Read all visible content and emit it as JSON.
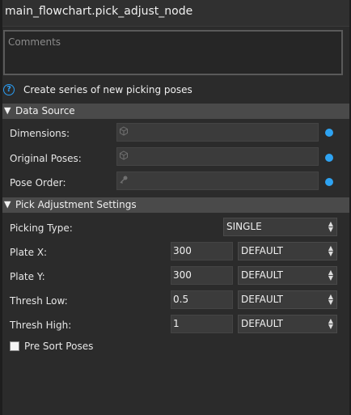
{
  "node": {
    "title": "main_flowchart.pick_adjust_node"
  },
  "comments": {
    "placeholder": "Comments"
  },
  "info": {
    "text": "Create series of new picking poses",
    "icon": "help-circle-icon"
  },
  "sections": {
    "data_source": {
      "title": "Data Source"
    },
    "pick_adjust": {
      "title": "Pick Adjustment Settings"
    }
  },
  "data_source": {
    "dimensions": {
      "label": "Dimensions:"
    },
    "original_poses": {
      "label": "Original Poses:"
    },
    "pose_order": {
      "label": "Pose Order:"
    }
  },
  "pick_adjust": {
    "picking_type": {
      "label": "Picking Type:",
      "value": "SINGLE"
    },
    "plate_x": {
      "label": "Plate X:",
      "value": "300",
      "mode": "DEFAULT"
    },
    "plate_y": {
      "label": "Plate Y:",
      "value": "300",
      "mode": "DEFAULT"
    },
    "thresh_low": {
      "label": "Thresh Low:",
      "value": "0.5",
      "mode": "DEFAULT"
    },
    "thresh_high": {
      "label": "Thresh High:",
      "value": "1",
      "mode": "DEFAULT"
    },
    "pre_sort": {
      "label": "Pre Sort Poses",
      "checked": false
    }
  },
  "colors": {
    "accent": "#2ea3f2",
    "header_bg": "#4a4a4a",
    "panel_bg": "#2b2b2b"
  }
}
